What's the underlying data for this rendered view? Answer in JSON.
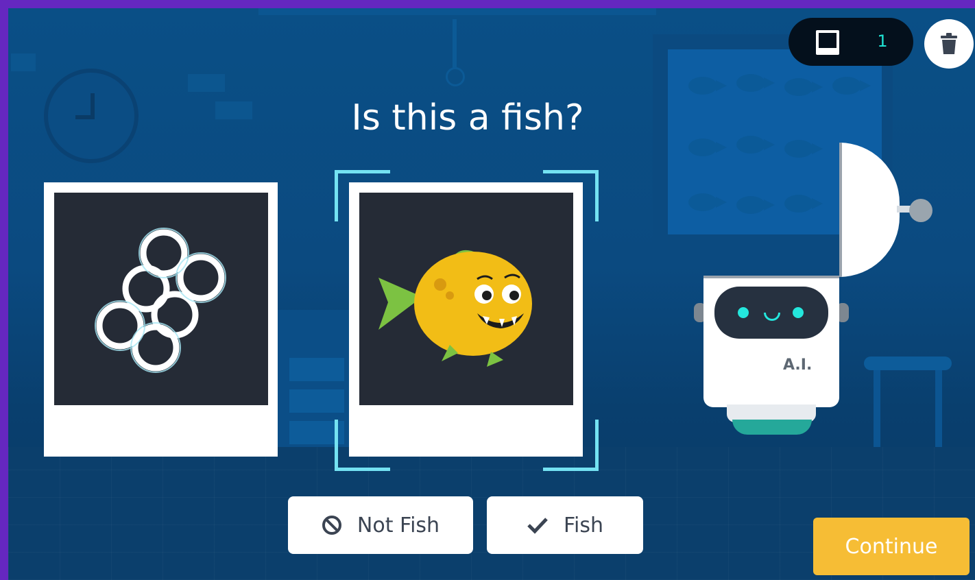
{
  "question": "Is this a fish?",
  "counter": {
    "icon": "photo-frame-icon",
    "value": "1"
  },
  "trash": {
    "icon": "trash-icon"
  },
  "cards": [
    {
      "subject": "rings-molecule-shape",
      "selected": false
    },
    {
      "subject": "yellow-cartoon-fish",
      "selected": true
    }
  ],
  "buttons": {
    "not_fish": {
      "label": "Not Fish",
      "icon": "prohibited-icon"
    },
    "fish": {
      "label": "Fish",
      "icon": "checkmark-icon"
    },
    "continue": {
      "label": "Continue"
    }
  },
  "robot": {
    "label": "A.I."
  },
  "colors": {
    "frame": "#6527c0",
    "accent_cyan": "#74e2f2",
    "continue_bg": "#f6bd35",
    "counter_text": "#1fe3d3"
  }
}
